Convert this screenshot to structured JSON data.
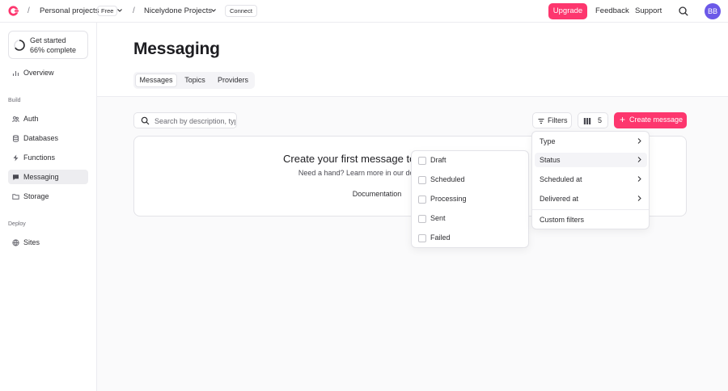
{
  "topbar": {
    "org": "Personal projects",
    "plan_badge": "Free",
    "project": "Nicelydone Projects",
    "connect": "Connect",
    "upgrade": "Upgrade",
    "feedback": "Feedback",
    "support": "Support",
    "avatar_initials": "BB",
    "separator": "/"
  },
  "sidebar": {
    "get_started": {
      "title": "Get started",
      "progress_text": "66% complete",
      "progress": 0.66
    },
    "overview": "Overview",
    "build_label": "Build",
    "build_items": [
      {
        "label": "Auth",
        "icon": "user-icon"
      },
      {
        "label": "Databases",
        "icon": "database-icon"
      },
      {
        "label": "Functions",
        "icon": "lightning-icon"
      },
      {
        "label": "Messaging",
        "icon": "chat-icon",
        "active": true
      },
      {
        "label": "Storage",
        "icon": "folder-icon"
      }
    ],
    "deploy_label": "Deploy",
    "deploy_items": [
      {
        "label": "Sites",
        "icon": "globe-icon"
      }
    ]
  },
  "page": {
    "title": "Messaging",
    "tabs": [
      "Messages",
      "Topics",
      "Providers"
    ],
    "active_tab": "Messages"
  },
  "toolbar": {
    "search_placeholder": "Search by description, type, status, or ID",
    "filters": "Filters",
    "columns_count": "5",
    "create": "Create message"
  },
  "empty_state": {
    "title": "Create your first message to get started.",
    "subtitle": "Need a hand? Learn more in our documentation.",
    "documentation": "Documentation"
  },
  "filters_menu": {
    "items": [
      "Type",
      "Status",
      "Scheduled at",
      "Delivered at"
    ],
    "hovered": "Status",
    "custom": "Custom filters"
  },
  "status_menu": {
    "options": [
      "Draft",
      "Scheduled",
      "Processing",
      "Sent",
      "Failed"
    ]
  },
  "colors": {
    "brand": "#fd366e",
    "avatar": "#6b58e8"
  }
}
